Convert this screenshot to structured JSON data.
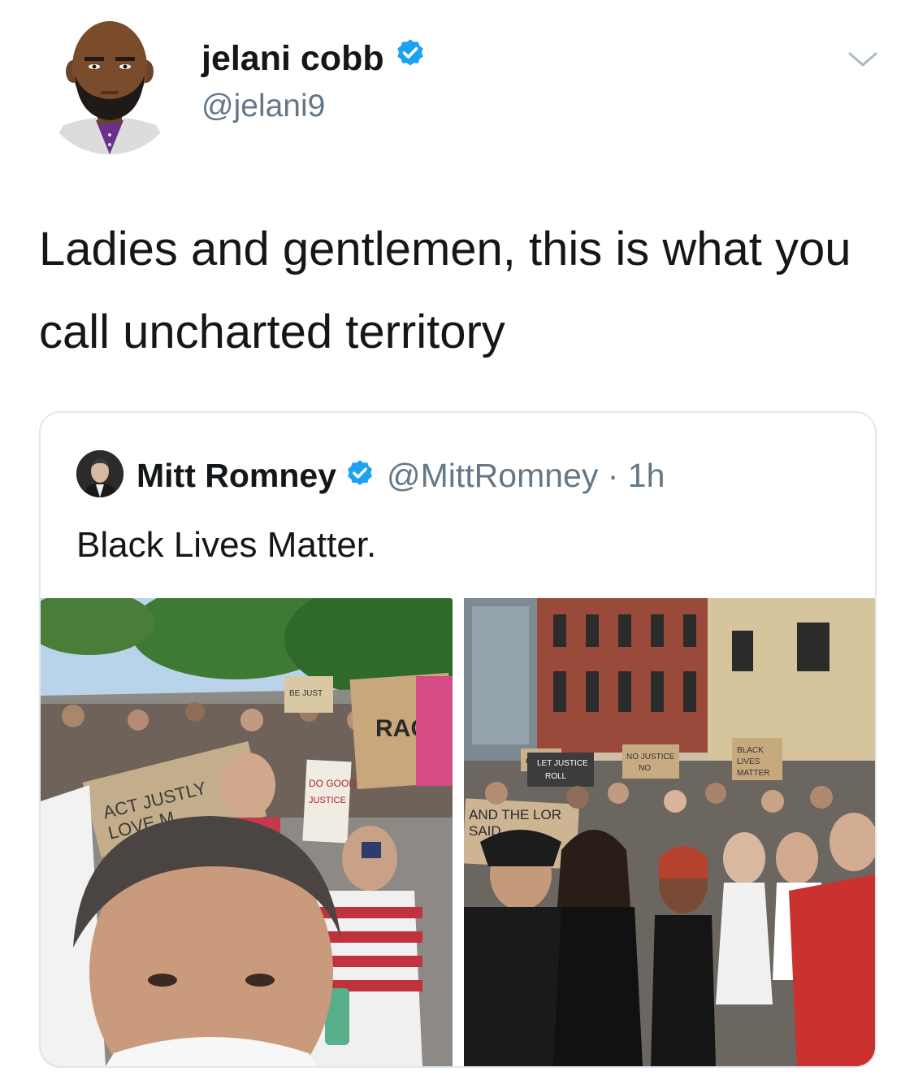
{
  "tweet": {
    "author": {
      "name": "jelani cobb",
      "handle": "@jelani9",
      "verified": true,
      "avatar_icon": "bearded-man-avatar-icon"
    },
    "text": "Ladies and gentlemen, this is what you call uncharted territory"
  },
  "quoted_tweet": {
    "author": {
      "name": "Mitt Romney",
      "handle": "@MittRomney",
      "verified": true
    },
    "separator": " · ",
    "time": "1h",
    "text": "Black Lives Matter.",
    "photos": {
      "left": {
        "signs": [
          "RACIS",
          "ACT JUSTLY LOVE M WAL",
          "DO GOOD JUSTICE",
          "BE JUST"
        ]
      },
      "right": {
        "signs": [
          "AND THE LOR SAID",
          "LET JUSTICE ROLL",
          "GOD",
          "BLACK LIVES MATTER",
          "NO JUSTICE NO"
        ]
      }
    }
  },
  "colors": {
    "verified": "#1da1f2",
    "secondary_text": "#657786",
    "border": "#e1e8ed"
  }
}
